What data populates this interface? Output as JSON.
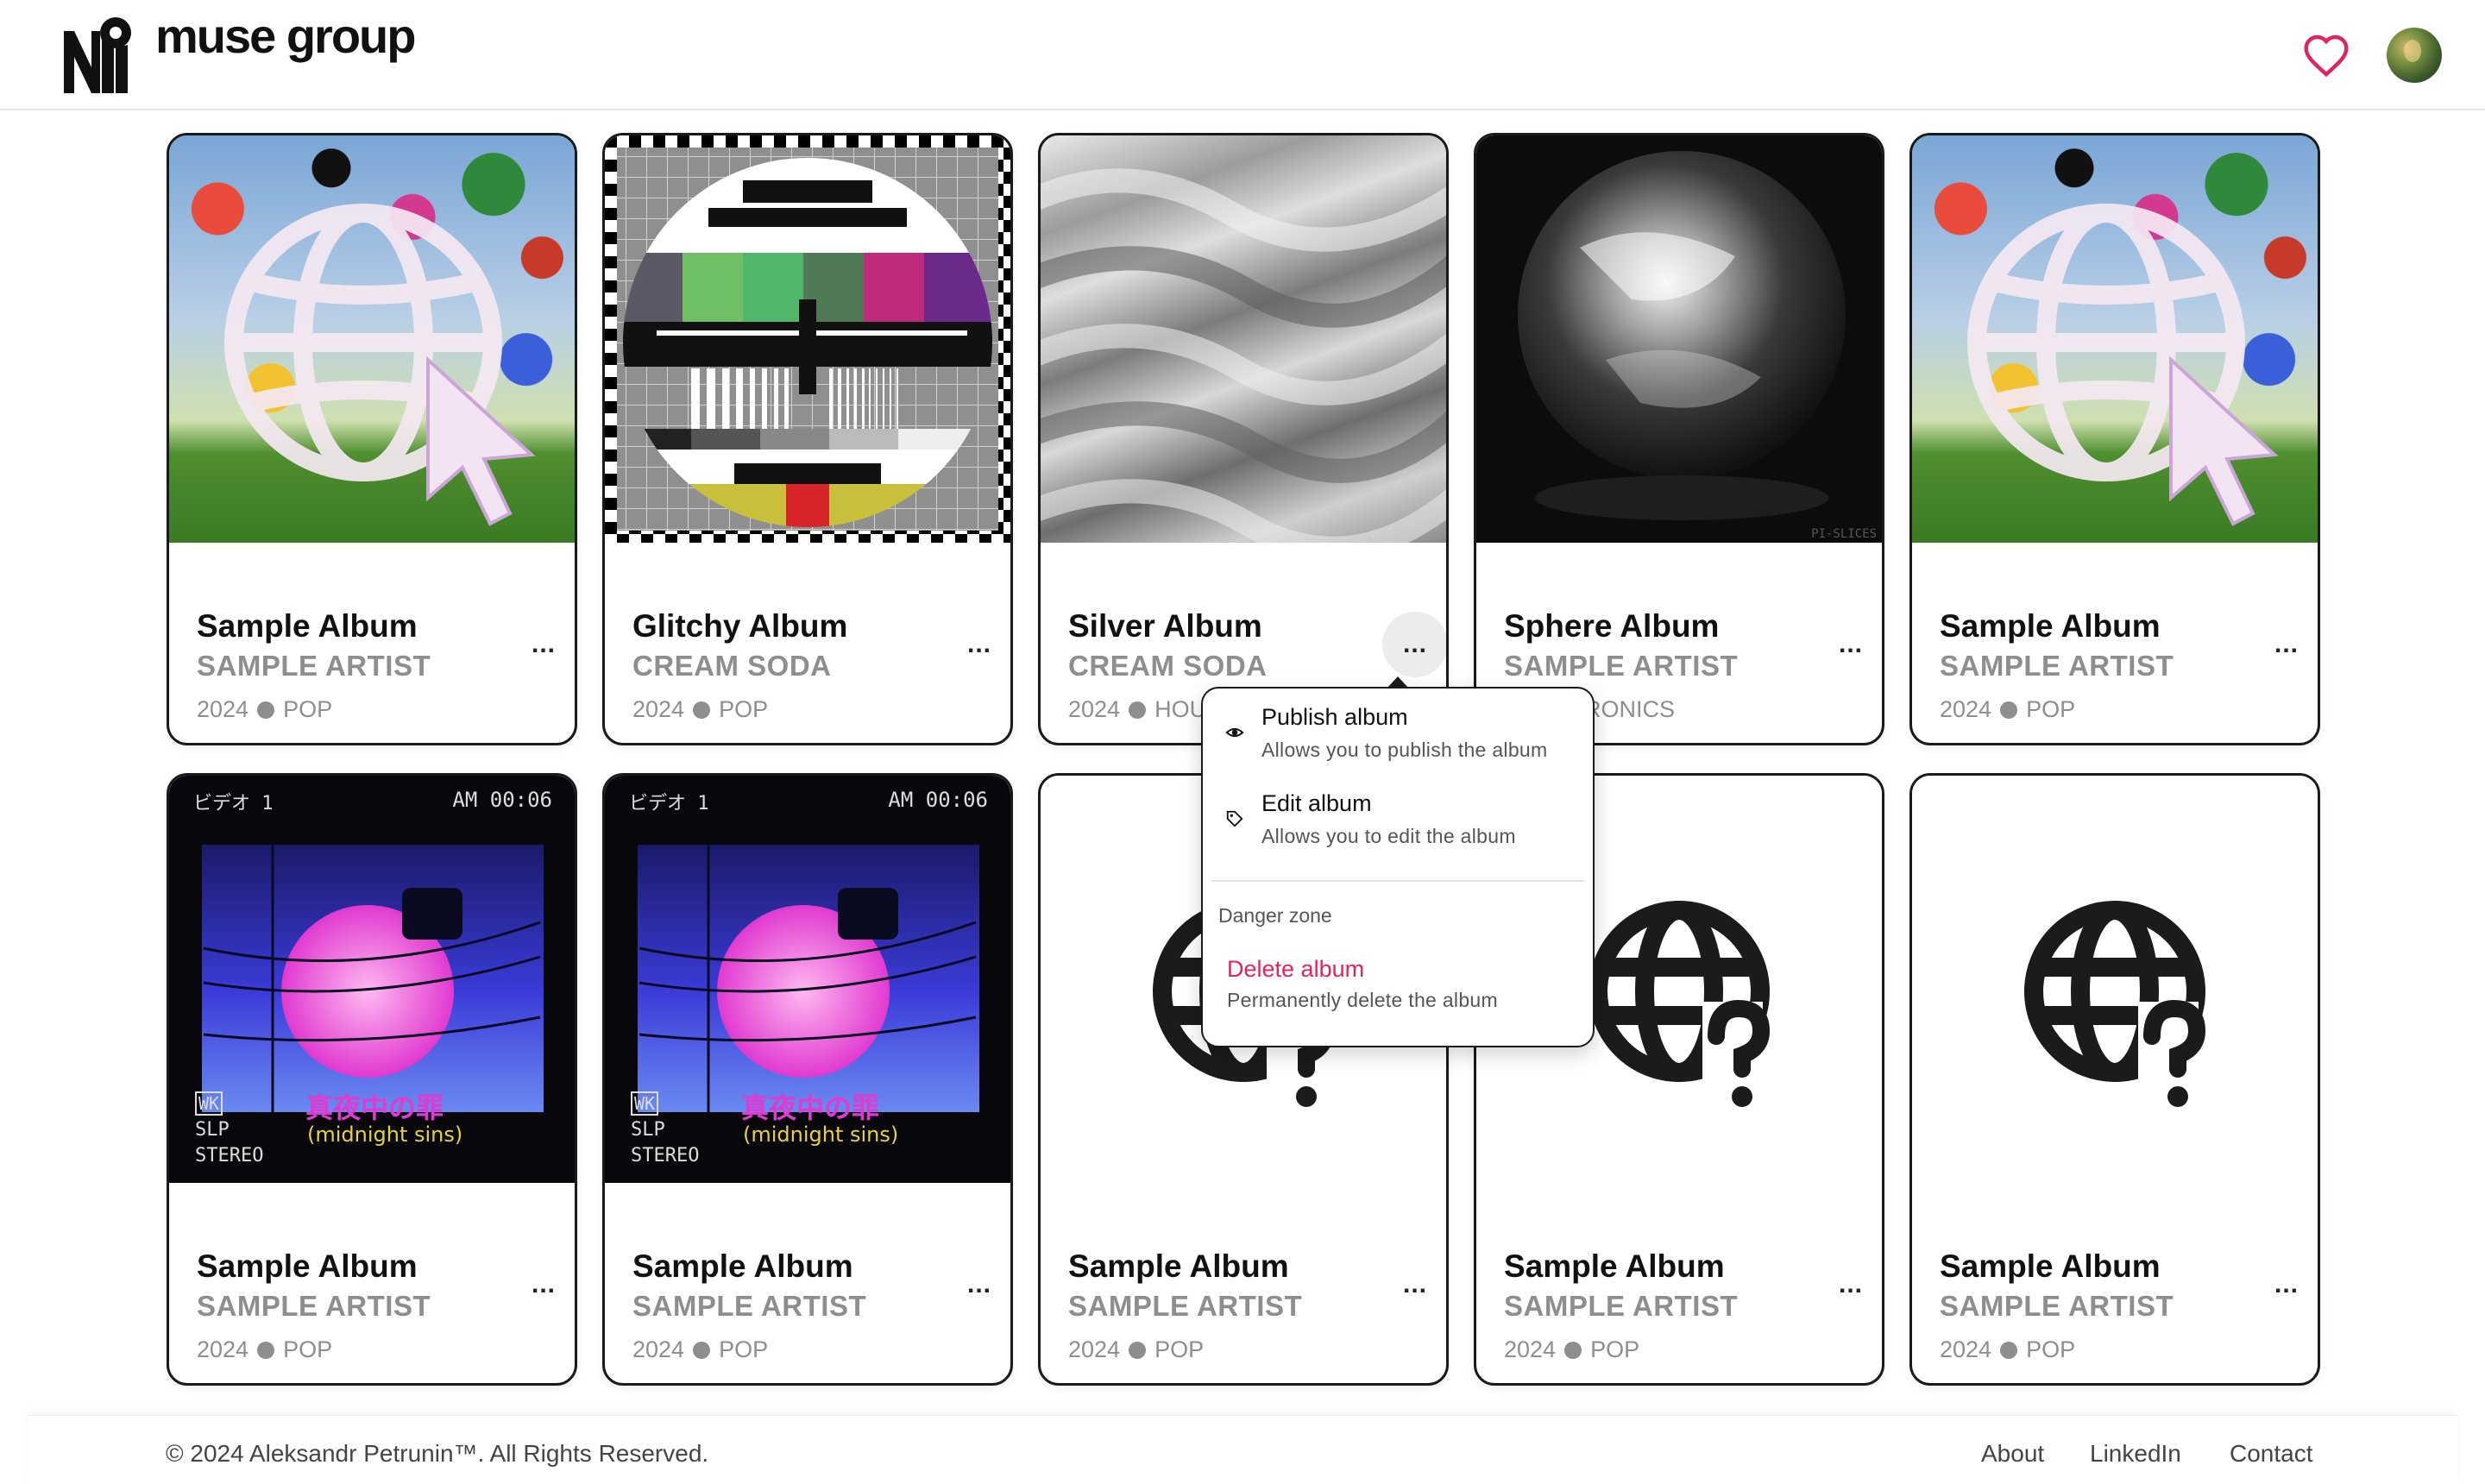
{
  "header": {
    "brand": "muse group",
    "favorites_icon": "heart-icon",
    "avatar_icon": "user-avatar"
  },
  "albums": [
    {
      "title": "Sample Album",
      "artist": "SAMPLE ARTIST",
      "year": "2024",
      "genre": "POP",
      "more": "...",
      "cover": "globe-collage"
    },
    {
      "title": "Glitchy Album",
      "artist": "CREAM SODA",
      "year": "2024",
      "genre": "POP",
      "more": "...",
      "cover": "tv-test-pattern"
    },
    {
      "title": "Silver Album",
      "artist": "CREAM SODA",
      "year": "2024",
      "genre": "HOU",
      "more": "...",
      "cover": "silver-waves"
    },
    {
      "title": "Sphere Album",
      "artist": "SAMPLE ARTIST",
      "year": "",
      "genre": "ELECTRONICS",
      "more": "...",
      "cover": "glass-sphere",
      "cover_caption": "PI-SLICES"
    },
    {
      "title": "Sample Album",
      "artist": "SAMPLE ARTIST",
      "year": "2024",
      "genre": "POP",
      "more": "...",
      "cover": "globe-collage"
    },
    {
      "title": "Sample Album",
      "artist": "SAMPLE ARTIST",
      "year": "2024",
      "genre": "POP",
      "more": "...",
      "cover": "midnight-sins"
    },
    {
      "title": "Sample Album",
      "artist": "SAMPLE ARTIST",
      "year": "2024",
      "genre": "POP",
      "more": "...",
      "cover": "midnight-sins"
    },
    {
      "title": "Sample Album",
      "artist": "SAMPLE ARTIST",
      "year": "2024",
      "genre": "POP",
      "more": "...",
      "cover": "globe-question-icon"
    },
    {
      "title": "Sample Album",
      "artist": "SAMPLE ARTIST",
      "year": "2024",
      "genre": "POP",
      "more": "...",
      "cover": "globe-question-icon"
    },
    {
      "title": "Sample Album",
      "artist": "SAMPLE ARTIST",
      "year": "2024",
      "genre": "POP",
      "more": "...",
      "cover": "globe-question-icon"
    }
  ],
  "midnight_cover": {
    "top_left": "ビデオ 1",
    "top_right": "AM 00:06",
    "label_wk": "WK",
    "label_slp": "SLP",
    "label_stereo": "STEREO",
    "title_jp": "真夜中の罪",
    "title_en": "(midnight sins)"
  },
  "menu": {
    "publish_title": "Publish album",
    "publish_desc": "Allows you to publish the album",
    "edit_title": "Edit album",
    "edit_desc": "Allows you to edit the album",
    "section": "Danger zone",
    "delete_title": "Delete album",
    "delete_desc": "Permanently delete the album",
    "publish_icon": "eye-icon",
    "edit_icon": "tag-icon"
  },
  "colors": {
    "danger": "#e0245e",
    "muted": "#8e8e8e",
    "border": "#1a1a1a",
    "heart": "#e0245e"
  },
  "footer": {
    "copyright": "© 2024 Aleksandr Petrunin™. All Rights Reserved.",
    "links": [
      "About",
      "LinkedIn",
      "Contact"
    ]
  }
}
